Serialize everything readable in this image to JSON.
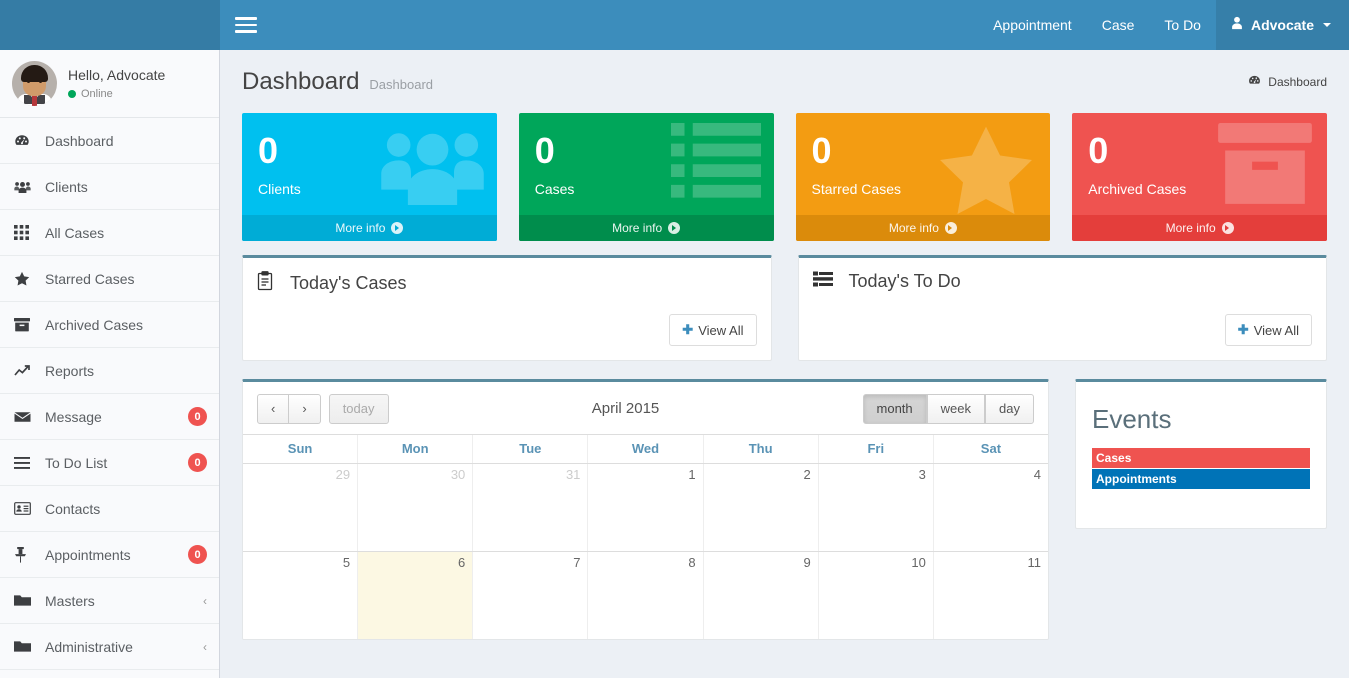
{
  "header": {
    "menu_toggle_icon": "hamburger-icon",
    "nav_links": [
      {
        "label": "Appointment"
      },
      {
        "label": "Case"
      },
      {
        "label": "To Do"
      }
    ],
    "user_menu": {
      "label": "Advocate",
      "icon": "user-icon",
      "caret": "caret-down-icon"
    }
  },
  "sidebar": {
    "user_panel": {
      "greeting": "Hello, Advocate",
      "status": "Online"
    },
    "items": [
      {
        "label": "Dashboard",
        "icon": "dashboard-icon",
        "badge": null,
        "chevron": null
      },
      {
        "label": "Clients",
        "icon": "users-icon",
        "badge": null,
        "chevron": null
      },
      {
        "label": "All Cases",
        "icon": "grid-icon",
        "badge": null,
        "chevron": null
      },
      {
        "label": "Starred Cases",
        "icon": "star-icon",
        "badge": null,
        "chevron": null
      },
      {
        "label": "Archived Cases",
        "icon": "archive-icon",
        "badge": null,
        "chevron": null
      },
      {
        "label": "Reports",
        "icon": "chart-line-icon",
        "badge": null,
        "chevron": null
      },
      {
        "label": "Message",
        "icon": "envelope-icon",
        "badge": "0",
        "chevron": null
      },
      {
        "label": "To Do List",
        "icon": "list-icon",
        "badge": "0",
        "chevron": null
      },
      {
        "label": "Contacts",
        "icon": "contacts-icon",
        "badge": null,
        "chevron": null
      },
      {
        "label": "Appointments",
        "icon": "pin-icon",
        "badge": "0",
        "chevron": null
      },
      {
        "label": "Masters",
        "icon": "folder-icon",
        "badge": null,
        "chevron": "‹"
      },
      {
        "label": "Administrative",
        "icon": "folder-icon",
        "badge": null,
        "chevron": "‹"
      }
    ]
  },
  "page": {
    "title": "Dashboard",
    "subtitle": "Dashboard",
    "breadcrumb": {
      "icon": "dashboard-icon",
      "label": "Dashboard"
    }
  },
  "stat_boxes": [
    {
      "number": "0",
      "label": "Clients",
      "footer": "More info",
      "icon": "users-icon",
      "color": "#00c0ef"
    },
    {
      "number": "0",
      "label": "Cases",
      "footer": "More info",
      "icon": "list-icon",
      "color": "#00a65a"
    },
    {
      "number": "0",
      "label": "Starred Cases",
      "footer": "More info",
      "icon": "star-icon",
      "color": "#f39c12"
    },
    {
      "number": "0",
      "label": "Archived Cases",
      "footer": "More info",
      "icon": "archive-icon",
      "color": "#ef5350"
    }
  ],
  "panels": [
    {
      "title": "Today's Cases",
      "icon": "clipboard-icon",
      "view_all": "View All"
    },
    {
      "title": "Today's To Do",
      "icon": "tasks-icon",
      "view_all": "View All"
    }
  ],
  "calendar": {
    "prev_label": "‹",
    "next_label": "›",
    "today_label": "today",
    "title": "April 2015",
    "views": [
      {
        "label": "month",
        "active": true
      },
      {
        "label": "week",
        "active": false
      },
      {
        "label": "day",
        "active": false
      }
    ],
    "day_headers": [
      "Sun",
      "Mon",
      "Tue",
      "Wed",
      "Thu",
      "Fri",
      "Sat"
    ],
    "weeks": [
      [
        {
          "num": "29",
          "other": true,
          "today": false
        },
        {
          "num": "30",
          "other": true,
          "today": false
        },
        {
          "num": "31",
          "other": true,
          "today": false
        },
        {
          "num": "1",
          "other": false,
          "today": false
        },
        {
          "num": "2",
          "other": false,
          "today": false
        },
        {
          "num": "3",
          "other": false,
          "today": false
        },
        {
          "num": "4",
          "other": false,
          "today": false
        }
      ],
      [
        {
          "num": "5",
          "other": false,
          "today": false
        },
        {
          "num": "6",
          "other": false,
          "today": true
        },
        {
          "num": "7",
          "other": false,
          "today": false
        },
        {
          "num": "8",
          "other": false,
          "today": false
        },
        {
          "num": "9",
          "other": false,
          "today": false
        },
        {
          "num": "10",
          "other": false,
          "today": false
        },
        {
          "num": "11",
          "other": false,
          "today": false
        }
      ]
    ]
  },
  "events": {
    "title": "Events",
    "items": [
      {
        "label": "Cases",
        "color": "#ef5350"
      },
      {
        "label": "Appointments",
        "color": "#0073b7"
      }
    ]
  },
  "colors": {
    "brand": "#3c8dbc",
    "brand_dark": "#357ca5",
    "panel_accent": "#5a8b9e",
    "content_bg": "#ecf0f5",
    "badge_red": "#ef5350",
    "online_green": "#00a65a"
  }
}
